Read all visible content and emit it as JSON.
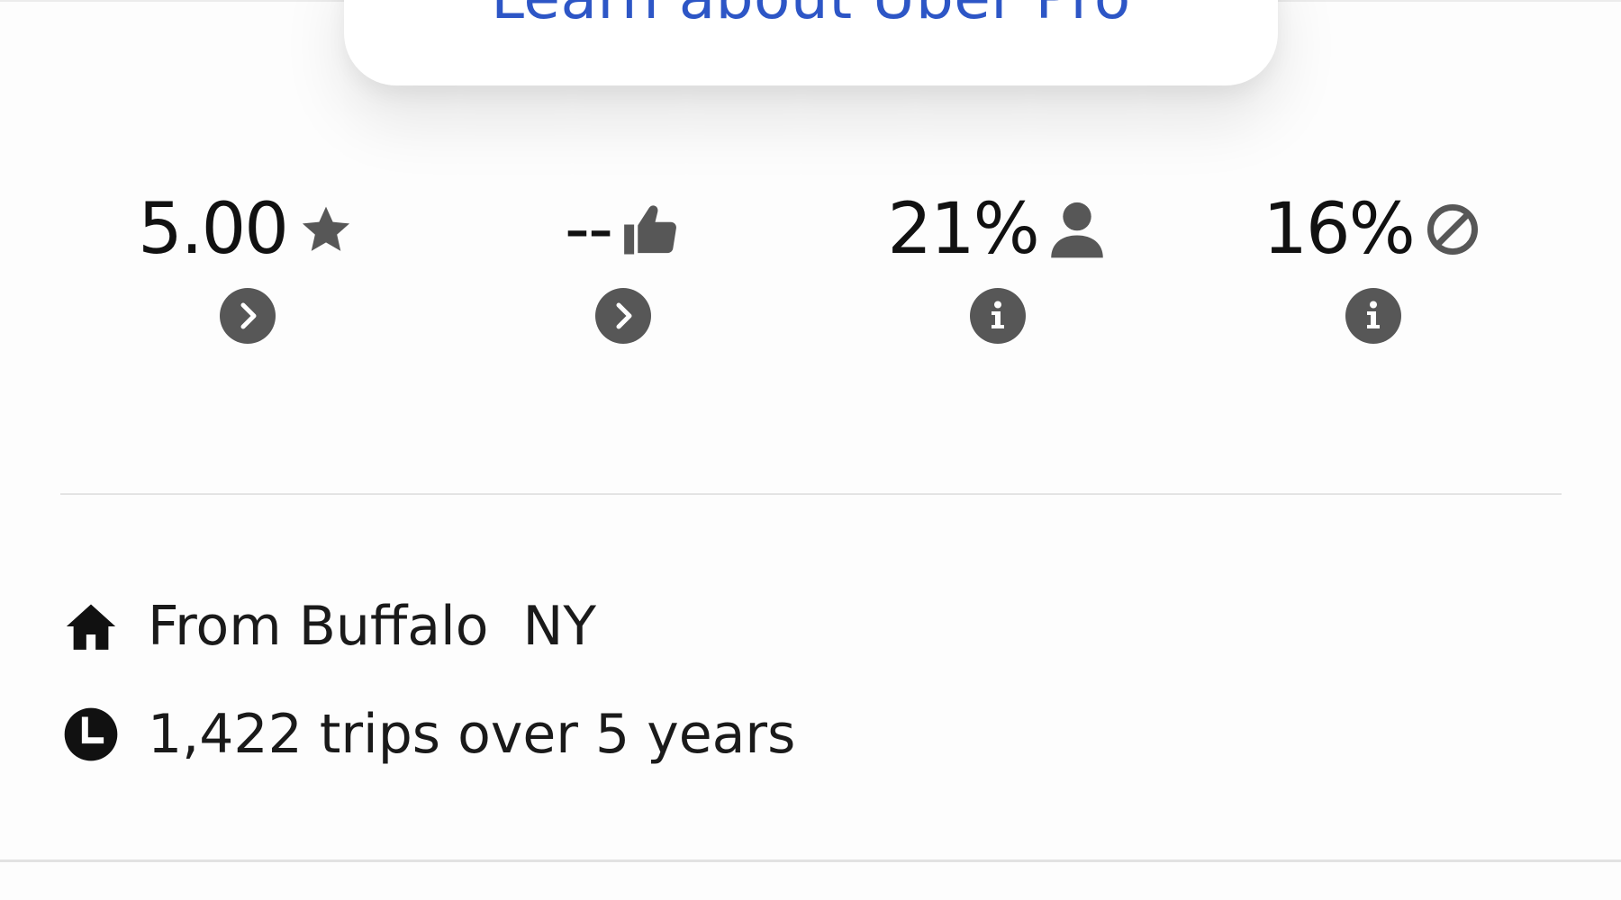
{
  "pro_card": {
    "label": "Learn about Uber Pro",
    "accent_color": "#2d56c6"
  },
  "stats": [
    {
      "value": "5.00",
      "icon": "star-icon",
      "action_icon": "chevron-right-icon"
    },
    {
      "value": "--",
      "icon": "thumbs-up-icon",
      "action_icon": "chevron-right-icon"
    },
    {
      "value": "21%",
      "icon": "person-icon",
      "action_icon": "info-icon"
    },
    {
      "value": "16%",
      "icon": "cancel-icon",
      "action_icon": "info-icon"
    }
  ],
  "details": {
    "hometown": {
      "icon": "home-icon",
      "text": "From Buffalo  NY"
    },
    "trips": {
      "icon": "clock-icon",
      "text": "1,422 trips over 5 years"
    }
  },
  "colors": {
    "icon_gray": "#575757",
    "text": "#111111",
    "divider": "#e4e4e4"
  }
}
